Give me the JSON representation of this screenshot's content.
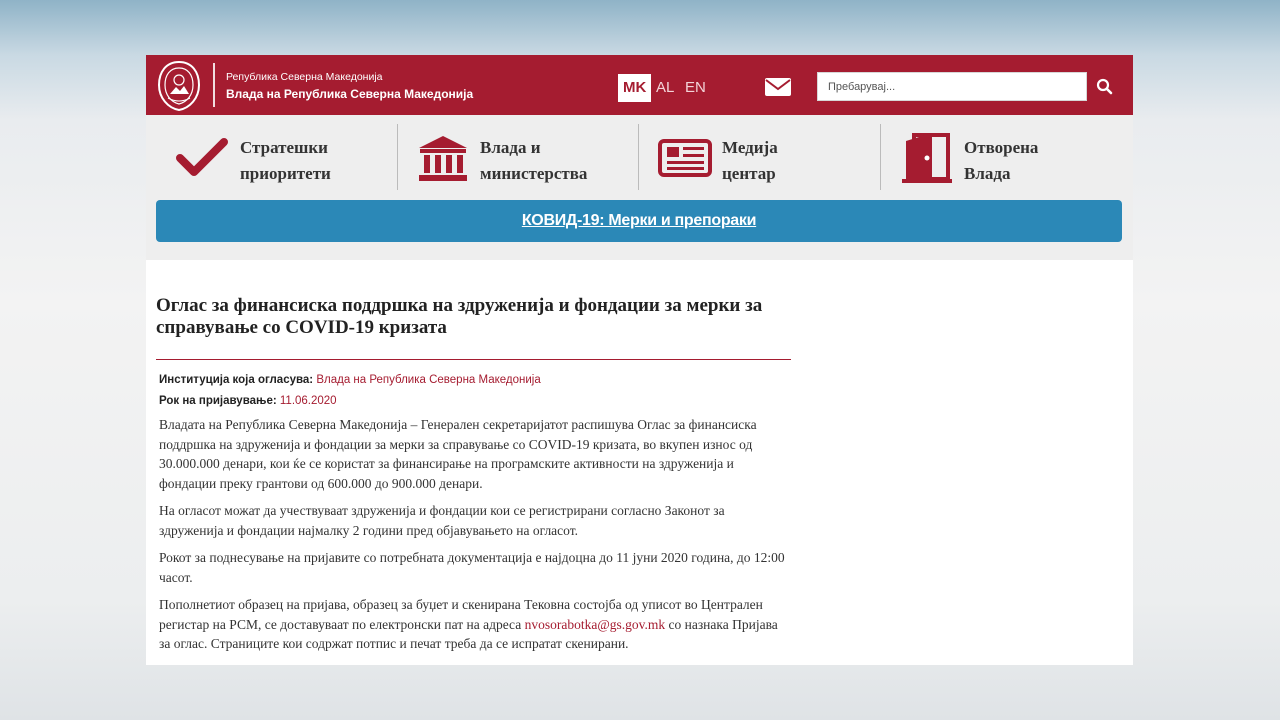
{
  "header": {
    "country_small": "Република Северна Македонија",
    "government_name": "Влада на Република Северна Македонија",
    "languages": [
      {
        "code": "MK",
        "active": true
      },
      {
        "code": "AL",
        "active": false
      },
      {
        "code": "EN",
        "active": false
      }
    ],
    "mail_icon": "envelope-icon",
    "search": {
      "placeholder": "Пребарувај...",
      "value": "",
      "icon": "search-icon"
    }
  },
  "nav": {
    "items": [
      {
        "line1": "Стратешки",
        "line2": "приоритети",
        "icon": "checkmark-icon"
      },
      {
        "line1": "Влада и",
        "line2": "министерства",
        "icon": "government-building-icon"
      },
      {
        "line1": "Медија",
        "line2": "центар",
        "icon": "newspaper-icon"
      },
      {
        "line1": "Отворена",
        "line2": "Влада",
        "icon": "open-door-icon"
      }
    ],
    "covid_link": "КОВИД-19: Мерки и препораки"
  },
  "article": {
    "title": "Оглас за финансиска поддршка на здруженија и фондации за мерки за справување со COVID-19 кризата",
    "institution_label": "Институција која огласува:",
    "institution_value": "Влада на Република Северна Македонија",
    "deadline_label": "Рок на пријавување:",
    "deadline_value": "11.06.2020",
    "paragraph1": "Владата на Република Северна Македонија – Генерален секретаријатот распишува Оглас за финансиска поддршка на здруженија и фондации за мерки за справување со COVID-19 кризата, во вкупен износ од 30.000.000 денари, кои ќе се користат за финансирање на програмските активности на здруженија и фондации преку грантови од 600.000 до 900.000 денари.",
    "paragraph2": "На огласот можат да учествуваат здруженија и фондации кои се регистрирани согласно Законот за здруженија и фондации најмалку 2 години пред објавувањето на огласот.",
    "paragraph3": "Рокот за поднесување на пријавите со потребната документација е најдоцна до 11 јуни 2020 година, до 12:00 часот.",
    "paragraph4_before": "Пополнетиот образец на пријава, образец за буџет и скенирана Тековна состојба од уписот во Централен регистар на РСМ, се доставуваат по електронски пат на адреса ",
    "paragraph4_email": "nvosorabotka@gs.gov.mk",
    "paragraph4_after": " со назнака Пријава за оглас. Страниците кои содржат потпис и печат треба да се испратат скенирани."
  },
  "colors": {
    "brand_red": "#a51c30",
    "covid_blue": "#2b88b7",
    "nav_bg": "#eeeeee"
  }
}
